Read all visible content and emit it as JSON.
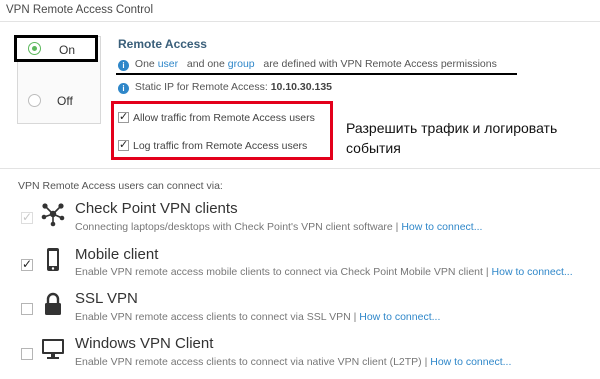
{
  "section_title": "VPN Remote Access Control",
  "toggle": {
    "on_label": "On",
    "off_label": "Off",
    "selected": "on"
  },
  "remote_access": {
    "title": "Remote Access",
    "info_prefix": "One",
    "user_link": "user",
    "info_mid": "and one",
    "group_link": "group",
    "info_suffix": "are defined with VPN Remote Access permissions",
    "static_ip_label": "Static IP for Remote Access:",
    "static_ip_value": "10.10.30.135"
  },
  "options": {
    "allow_traffic": "Allow traffic from Remote Access users",
    "log_traffic": "Log traffic from Remote Access users"
  },
  "annotation": "Разрешить трафик и логировать события",
  "users_title": "VPN Remote Access users can connect via:",
  "how_to": "How to connect...",
  "clients": [
    {
      "name": "Check Point VPN clients",
      "desc": "Connecting laptops/desktops with Check Point's VPN client software |",
      "icon": "network-nodes-icon",
      "checked": true,
      "disabled": true
    },
    {
      "name": "Mobile client",
      "desc": "Enable VPN remote access mobile clients to connect via Check Point Mobile VPN client |",
      "icon": "mobile-phone-icon",
      "checked": true,
      "disabled": false
    },
    {
      "name": "SSL VPN",
      "desc": "Enable VPN remote access clients to connect via SSL VPN |",
      "icon": "lock-icon",
      "checked": false,
      "disabled": false
    },
    {
      "name": "Windows VPN Client",
      "desc": "Enable VPN remote access clients to connect via native VPN client (L2TP) |",
      "icon": "monitor-icon",
      "checked": false,
      "disabled": false
    }
  ],
  "colors": {
    "link": "#2f87c9",
    "radio_on": "#5cb85c",
    "highlight_red": "#e3001b"
  }
}
